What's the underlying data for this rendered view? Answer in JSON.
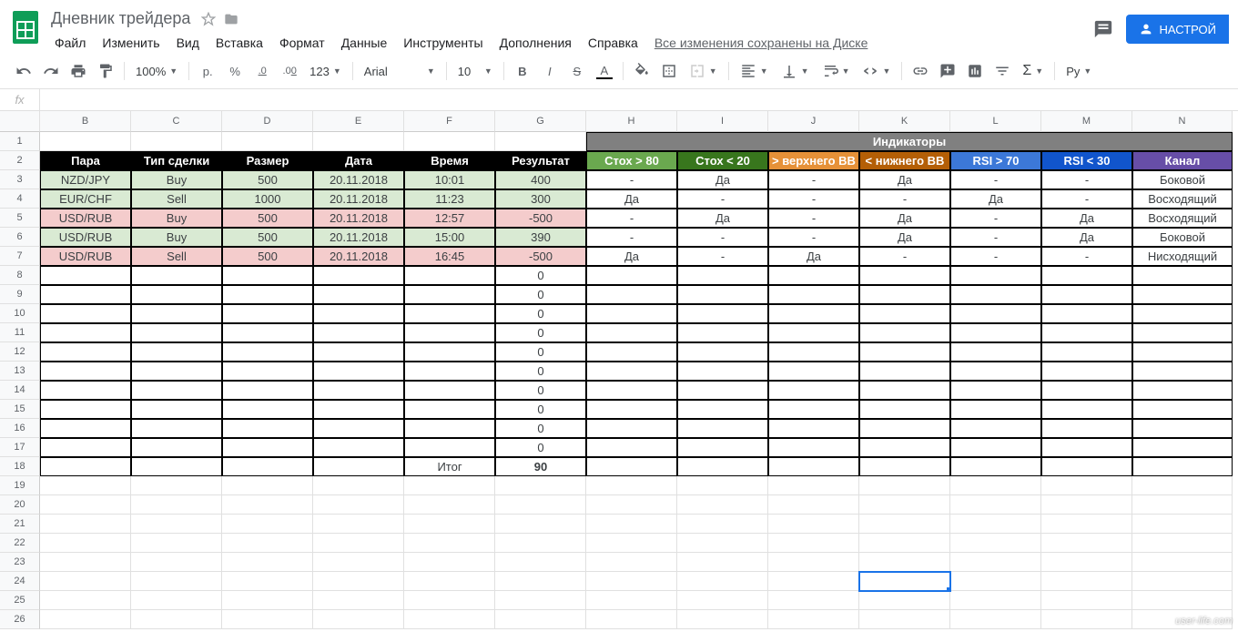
{
  "doc": {
    "title": "Дневник трейдера",
    "save_status": "Все изменения сохранены на Диске"
  },
  "menu": [
    "Файл",
    "Изменить",
    "Вид",
    "Вставка",
    "Формат",
    "Данные",
    "Инструменты",
    "Дополнения",
    "Справка"
  ],
  "share": {
    "label": "НАСТРОЙ"
  },
  "toolbar": {
    "zoom": "100%",
    "currency": "р.",
    "percent": "%",
    "dec_dec": ".0",
    "inc_dec": ".00",
    "format": "123",
    "font": "Arial",
    "size": "10",
    "bold": "B",
    "italic": "I",
    "strike": "S",
    "color": "A",
    "ruby": "Ру"
  },
  "fx": "fx",
  "cols": [
    "B",
    "C",
    "D",
    "E",
    "F",
    "G",
    "H",
    "I",
    "J",
    "K",
    "L",
    "M",
    "N"
  ],
  "col_widths": {
    "B": 100,
    "C": 100,
    "D": 100,
    "E": 100,
    "F": 100,
    "G": 100,
    "H": 100,
    "I": 100,
    "J": 100,
    "K": 100,
    "L": 100,
    "M": 100,
    "N": 110
  },
  "rows": [
    "1",
    "2",
    "3",
    "4",
    "5",
    "6",
    "7",
    "8",
    "9",
    "10",
    "11",
    "12",
    "13",
    "14",
    "15",
    "16",
    "17",
    "18",
    "19",
    "20",
    "21",
    "22",
    "23",
    "24",
    "25",
    "26"
  ],
  "indicators_label": "Индикаторы",
  "headers_left": [
    "Пара",
    "Тип сделки",
    "Размер",
    "Дата",
    "Время",
    "Результат"
  ],
  "headers_ind": [
    "Стох > 80",
    "Стох < 20",
    "> верхнего BB",
    "< нижнего BB",
    "RSI > 70",
    "RSI < 30",
    "Канал"
  ],
  "ind_classes": [
    "sec-green",
    "sec-green-d",
    "sec-orange",
    "sec-orange-d",
    "sec-blue",
    "sec-blue-d",
    "sec-purple"
  ],
  "trades": [
    {
      "pair": "NZD/JPY",
      "type": "Buy",
      "size": "500",
      "date": "20.11.2018",
      "time": "10:01",
      "result": "400",
      "bg": "bg-green-l",
      "ind": [
        "-",
        "Да",
        "-",
        "Да",
        "-",
        "-",
        "Боковой"
      ]
    },
    {
      "pair": "EUR/CHF",
      "type": "Sell",
      "size": "1000",
      "date": "20.11.2018",
      "time": "11:23",
      "result": "300",
      "bg": "bg-green-l",
      "ind": [
        "Да",
        "-",
        "-",
        "-",
        "Да",
        "-",
        "Восходящий"
      ]
    },
    {
      "pair": "USD/RUB",
      "type": "Buy",
      "size": "500",
      "date": "20.11.2018",
      "time": "12:57",
      "result": "-500",
      "bg": "bg-red-l",
      "ind": [
        "-",
        "Да",
        "-",
        "Да",
        "-",
        "Да",
        "Восходящий"
      ]
    },
    {
      "pair": "USD/RUB",
      "type": "Buy",
      "size": "500",
      "date": "20.11.2018",
      "time": "15:00",
      "result": "390",
      "bg": "bg-green-l",
      "ind": [
        "-",
        "-",
        "-",
        "Да",
        "-",
        "Да",
        "Боковой"
      ]
    },
    {
      "pair": "USD/RUB",
      "type": "Sell",
      "size": "500",
      "date": "20.11.2018",
      "time": "16:45",
      "result": "-500",
      "bg": "bg-red-l",
      "ind": [
        "Да",
        "-",
        "Да",
        "-",
        "-",
        "-",
        "Нисходящий"
      ]
    }
  ],
  "zeros_count": 10,
  "total": {
    "label": "Итог",
    "value": "90"
  },
  "selected": {
    "row": 24,
    "col": "K"
  },
  "watermark": "user-life.com"
}
